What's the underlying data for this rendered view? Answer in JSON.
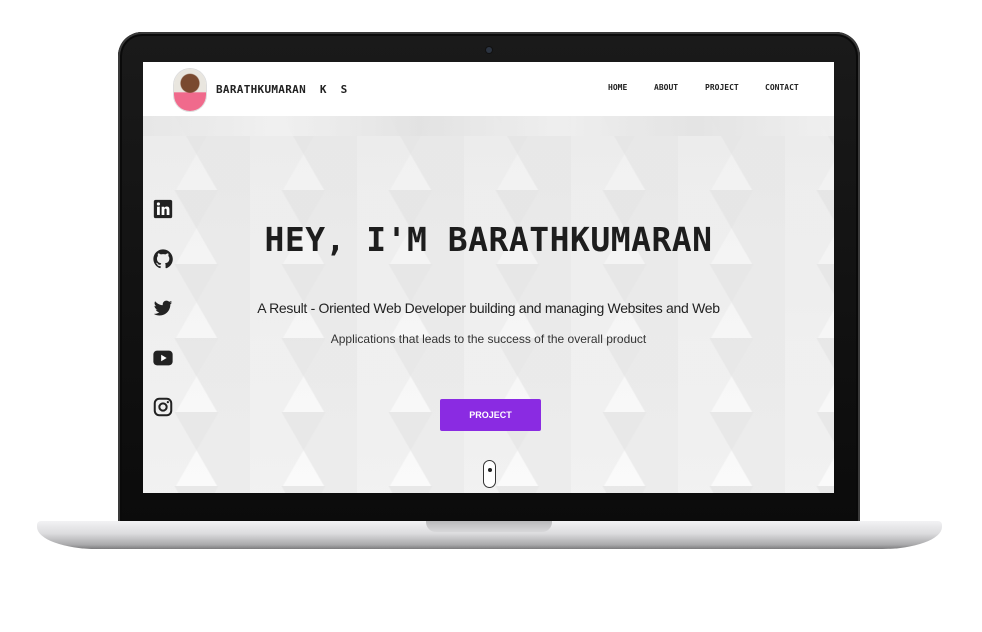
{
  "header": {
    "brand": "BARATHKUMARAN  K  S",
    "nav": [
      "HOME",
      "ABOUT",
      "PROJECT",
      "CONTACT"
    ]
  },
  "hero": {
    "title": "HEY, I'M BARATHKUMARAN",
    "tagline": "A Result - Oriented Web Developer building and managing Websites and Web",
    "subline": "Applications that leads to the success of the overall product",
    "cta_label": "PROJECT"
  },
  "social_icons": [
    "linkedin-icon",
    "github-icon",
    "twitter-icon",
    "youtube-icon",
    "instagram-icon"
  ],
  "colors": {
    "accent": "#8a2be2",
    "text": "#1d1d1d",
    "icon": "#222222"
  }
}
